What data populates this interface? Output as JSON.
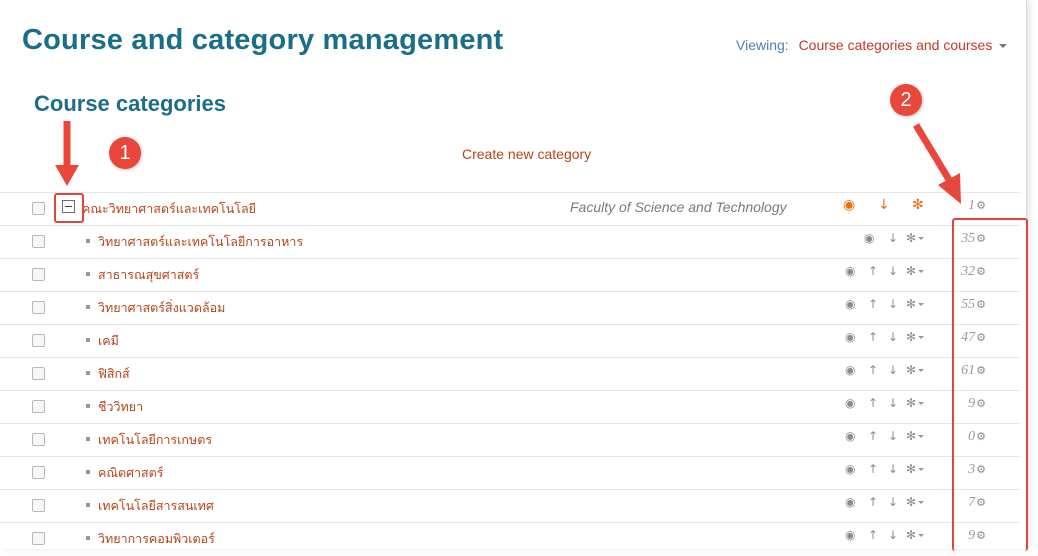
{
  "page": {
    "title": "Course and category management",
    "viewing_label": "Viewing:",
    "viewing_value": "Course categories and courses",
    "subtitle": "Course categories",
    "create_link": "Create new category"
  },
  "annotations": {
    "badge1": "1",
    "badge2": "2",
    "accent_color": "#e9473c"
  },
  "categories": [
    {
      "name": "คณะวิทยาศาสตร์และเทคโนโลยี",
      "idnumber": "Faculty of Science and Technology",
      "count": "1",
      "level": 0
    },
    {
      "name": "วิทยาศาสตร์และเทคโนโลยีการอาหาร",
      "count": "35",
      "level": 1
    },
    {
      "name": "สาธารณสุขศาสตร์",
      "count": "32",
      "level": 1
    },
    {
      "name": "วิทยาศาสตร์สิ่งแวดล้อม",
      "count": "55",
      "level": 1
    },
    {
      "name": "เคมี",
      "count": "47",
      "level": 1
    },
    {
      "name": "ฟิสิกส์",
      "count": "61",
      "level": 1
    },
    {
      "name": "ชีววิทยา",
      "count": "9",
      "level": 1
    },
    {
      "name": "เทคโนโลยีการเกษตร",
      "count": "0",
      "level": 1
    },
    {
      "name": "คณิตศาสตร์",
      "count": "3",
      "level": 1
    },
    {
      "name": "เทคโนโลยีสารสนเทศ",
      "count": "7",
      "level": 1
    },
    {
      "name": "วิทยาการคอมพิวเตอร์",
      "count": "9",
      "level": 1
    }
  ]
}
